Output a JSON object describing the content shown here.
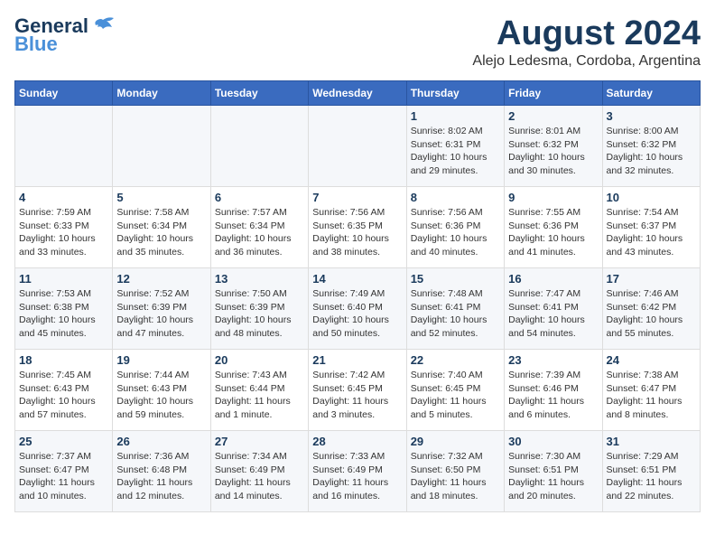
{
  "logo": {
    "line1": "General",
    "line2": "Blue"
  },
  "title": "August 2024",
  "subtitle": "Alejo Ledesma, Cordoba, Argentina",
  "days_of_week": [
    "Sunday",
    "Monday",
    "Tuesday",
    "Wednesday",
    "Thursday",
    "Friday",
    "Saturday"
  ],
  "weeks": [
    [
      {
        "day": "",
        "info": ""
      },
      {
        "day": "",
        "info": ""
      },
      {
        "day": "",
        "info": ""
      },
      {
        "day": "",
        "info": ""
      },
      {
        "day": "1",
        "info": "Sunrise: 8:02 AM\nSunset: 6:31 PM\nDaylight: 10 hours and 29 minutes."
      },
      {
        "day": "2",
        "info": "Sunrise: 8:01 AM\nSunset: 6:32 PM\nDaylight: 10 hours and 30 minutes."
      },
      {
        "day": "3",
        "info": "Sunrise: 8:00 AM\nSunset: 6:32 PM\nDaylight: 10 hours and 32 minutes."
      }
    ],
    [
      {
        "day": "4",
        "info": "Sunrise: 7:59 AM\nSunset: 6:33 PM\nDaylight: 10 hours and 33 minutes."
      },
      {
        "day": "5",
        "info": "Sunrise: 7:58 AM\nSunset: 6:34 PM\nDaylight: 10 hours and 35 minutes."
      },
      {
        "day": "6",
        "info": "Sunrise: 7:57 AM\nSunset: 6:34 PM\nDaylight: 10 hours and 36 minutes."
      },
      {
        "day": "7",
        "info": "Sunrise: 7:56 AM\nSunset: 6:35 PM\nDaylight: 10 hours and 38 minutes."
      },
      {
        "day": "8",
        "info": "Sunrise: 7:56 AM\nSunset: 6:36 PM\nDaylight: 10 hours and 40 minutes."
      },
      {
        "day": "9",
        "info": "Sunrise: 7:55 AM\nSunset: 6:36 PM\nDaylight: 10 hours and 41 minutes."
      },
      {
        "day": "10",
        "info": "Sunrise: 7:54 AM\nSunset: 6:37 PM\nDaylight: 10 hours and 43 minutes."
      }
    ],
    [
      {
        "day": "11",
        "info": "Sunrise: 7:53 AM\nSunset: 6:38 PM\nDaylight: 10 hours and 45 minutes."
      },
      {
        "day": "12",
        "info": "Sunrise: 7:52 AM\nSunset: 6:39 PM\nDaylight: 10 hours and 47 minutes."
      },
      {
        "day": "13",
        "info": "Sunrise: 7:50 AM\nSunset: 6:39 PM\nDaylight: 10 hours and 48 minutes."
      },
      {
        "day": "14",
        "info": "Sunrise: 7:49 AM\nSunset: 6:40 PM\nDaylight: 10 hours and 50 minutes."
      },
      {
        "day": "15",
        "info": "Sunrise: 7:48 AM\nSunset: 6:41 PM\nDaylight: 10 hours and 52 minutes."
      },
      {
        "day": "16",
        "info": "Sunrise: 7:47 AM\nSunset: 6:41 PM\nDaylight: 10 hours and 54 minutes."
      },
      {
        "day": "17",
        "info": "Sunrise: 7:46 AM\nSunset: 6:42 PM\nDaylight: 10 hours and 55 minutes."
      }
    ],
    [
      {
        "day": "18",
        "info": "Sunrise: 7:45 AM\nSunset: 6:43 PM\nDaylight: 10 hours and 57 minutes."
      },
      {
        "day": "19",
        "info": "Sunrise: 7:44 AM\nSunset: 6:43 PM\nDaylight: 10 hours and 59 minutes."
      },
      {
        "day": "20",
        "info": "Sunrise: 7:43 AM\nSunset: 6:44 PM\nDaylight: 11 hours and 1 minute."
      },
      {
        "day": "21",
        "info": "Sunrise: 7:42 AM\nSunset: 6:45 PM\nDaylight: 11 hours and 3 minutes."
      },
      {
        "day": "22",
        "info": "Sunrise: 7:40 AM\nSunset: 6:45 PM\nDaylight: 11 hours and 5 minutes."
      },
      {
        "day": "23",
        "info": "Sunrise: 7:39 AM\nSunset: 6:46 PM\nDaylight: 11 hours and 6 minutes."
      },
      {
        "day": "24",
        "info": "Sunrise: 7:38 AM\nSunset: 6:47 PM\nDaylight: 11 hours and 8 minutes."
      }
    ],
    [
      {
        "day": "25",
        "info": "Sunrise: 7:37 AM\nSunset: 6:47 PM\nDaylight: 11 hours and 10 minutes."
      },
      {
        "day": "26",
        "info": "Sunrise: 7:36 AM\nSunset: 6:48 PM\nDaylight: 11 hours and 12 minutes."
      },
      {
        "day": "27",
        "info": "Sunrise: 7:34 AM\nSunset: 6:49 PM\nDaylight: 11 hours and 14 minutes."
      },
      {
        "day": "28",
        "info": "Sunrise: 7:33 AM\nSunset: 6:49 PM\nDaylight: 11 hours and 16 minutes."
      },
      {
        "day": "29",
        "info": "Sunrise: 7:32 AM\nSunset: 6:50 PM\nDaylight: 11 hours and 18 minutes."
      },
      {
        "day": "30",
        "info": "Sunrise: 7:30 AM\nSunset: 6:51 PM\nDaylight: 11 hours and 20 minutes."
      },
      {
        "day": "31",
        "info": "Sunrise: 7:29 AM\nSunset: 6:51 PM\nDaylight: 11 hours and 22 minutes."
      }
    ]
  ]
}
